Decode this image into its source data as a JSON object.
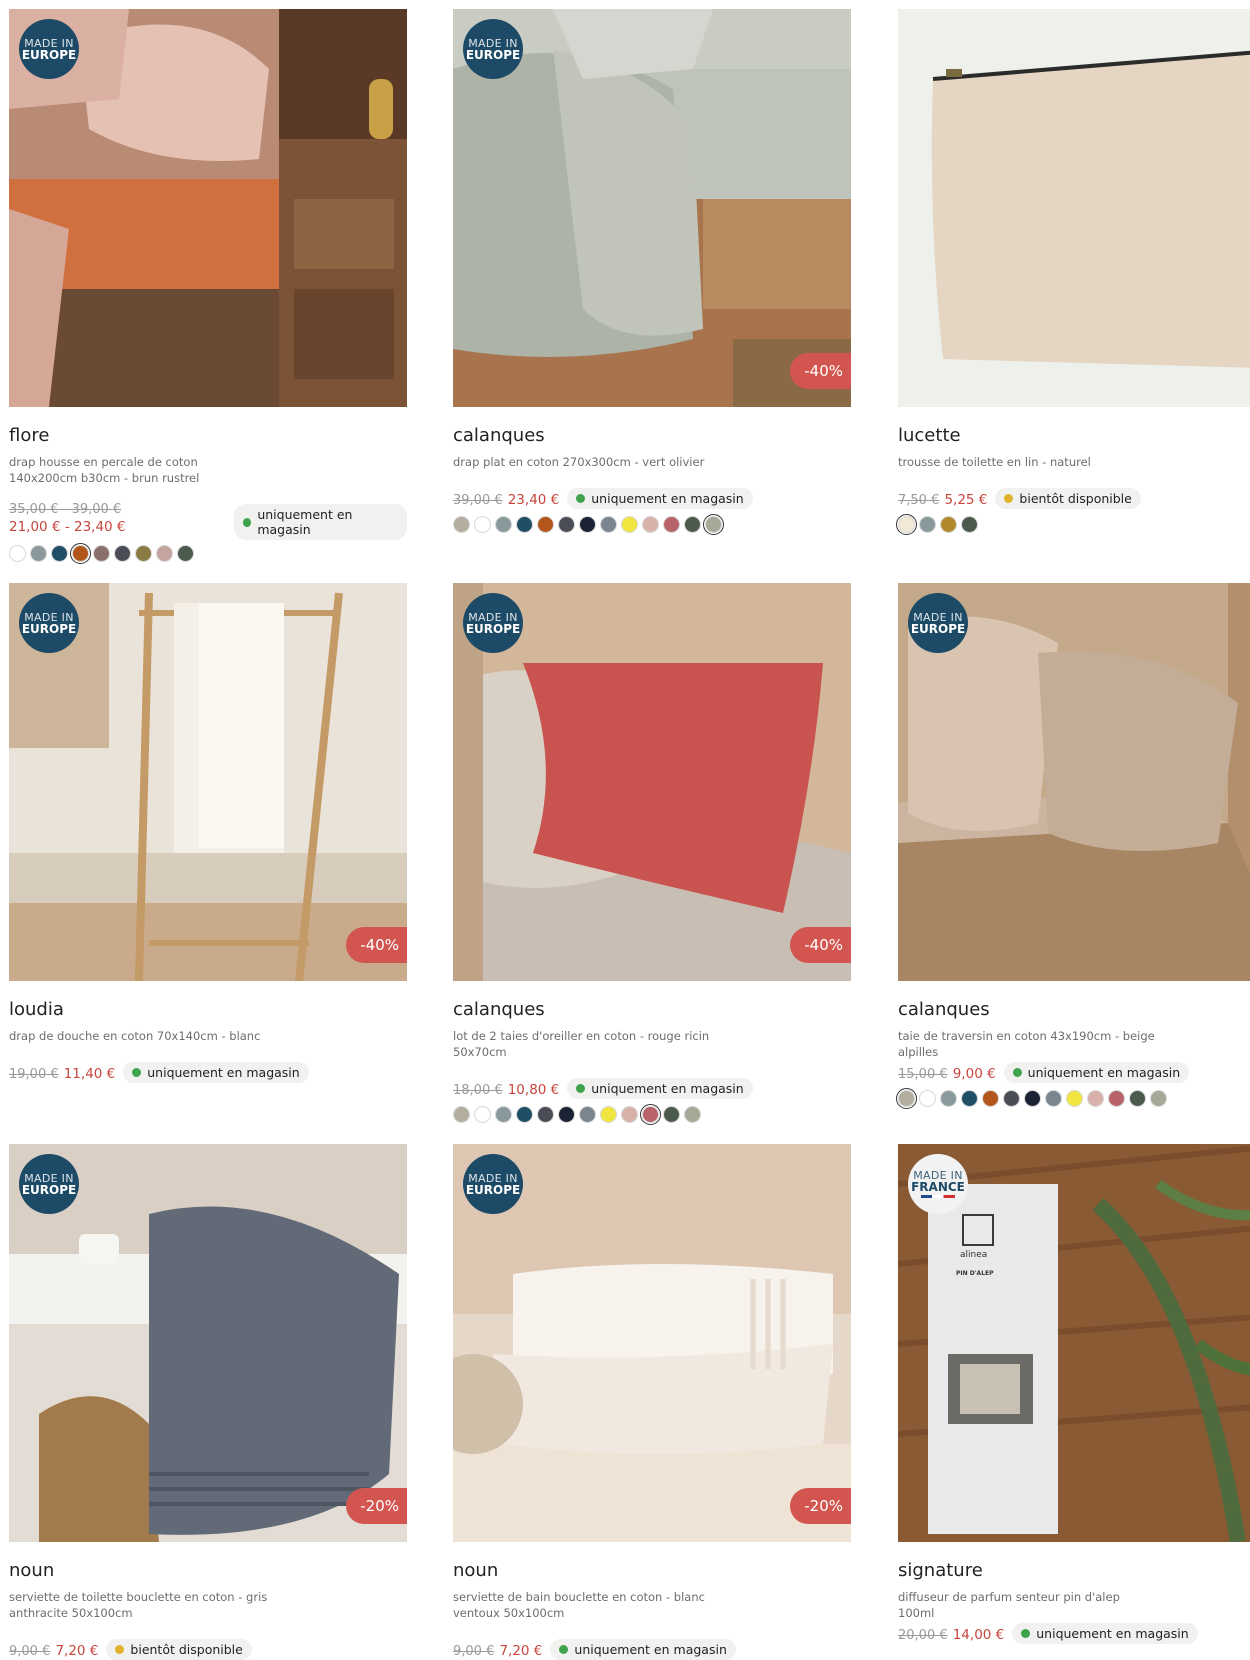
{
  "products": [
    {
      "id": "flore",
      "origin": {
        "line1": "MADE IN",
        "line2": "EUROPE",
        "type": "eu"
      },
      "discount": "",
      "name": "flore",
      "desc": "drap housse en percale de coton 140x200cm b30cm - brun rustrel",
      "old_price": "35,00 € - 39,00 €",
      "new_price": "21,00 € - 23,40 €",
      "status": {
        "label": "uniquement en magasin",
        "color": "#3fa34d"
      },
      "swatches": [
        "#ffffff",
        "#8a9a9c",
        "#1f4e66",
        "#b3561c",
        "#8a6f6a",
        "#4a4d55",
        "#8a7a44",
        "#c4a49e",
        "#4a5a4c"
      ],
      "selected_swatch": 3
    },
    {
      "id": "calanques-drap-plat",
      "origin": {
        "line1": "MADE IN",
        "line2": "EUROPE",
        "type": "eu"
      },
      "discount": "-40%",
      "name": "calanques",
      "desc": "drap plat en coton 270x300cm - vert olivier",
      "old_price": "39,00 €",
      "new_price": "23,40 €",
      "status": {
        "label": "uniquement en magasin",
        "color": "#3fa34d"
      },
      "swatches": [
        "#b4aea0",
        "#ffffff",
        "#8a9a9c",
        "#1f4e66",
        "#b3561c",
        "#4a4d55",
        "#1a2233",
        "#7a8590",
        "#f1e640",
        "#d8b2aa",
        "#b8636a",
        "#4a5a4c",
        "#a6a898"
      ],
      "selected_swatch": 12
    },
    {
      "id": "lucette",
      "origin": null,
      "discount": "cut",
      "name": "lucette",
      "desc": "trousse de toilette en lin - naturel",
      "old_price": "7,50 €",
      "new_price": "5,25 €",
      "status": {
        "label": "bientôt disponible",
        "color": "#e0b12a"
      },
      "swatches": [
        "#f3e8d6",
        "#8a9a9c",
        "#b08a2a",
        "#4a5a4c"
      ],
      "selected_swatch": 0
    },
    {
      "id": "loudia",
      "origin": {
        "line1": "MADE IN",
        "line2": "EUROPE",
        "type": "eu"
      },
      "discount": "-40%",
      "name": "loudia",
      "desc": "drap de douche en coton 70x140cm - blanc",
      "old_price": "19,00 €",
      "new_price": "11,40 €",
      "status": {
        "label": "uniquement en magasin",
        "color": "#3fa34d"
      },
      "swatches": [],
      "selected_swatch": -1
    },
    {
      "id": "calanques-taies",
      "origin": {
        "line1": "MADE IN",
        "line2": "EUROPE",
        "type": "eu"
      },
      "discount": "-40%",
      "name": "calanques",
      "desc": "lot de 2 taies d'oreiller en coton - rouge ricin 50x70cm",
      "old_price": "18,00 €",
      "new_price": "10,80 €",
      "status": {
        "label": "uniquement en magasin",
        "color": "#3fa34d"
      },
      "swatches": [
        "#b4aea0",
        "#ffffff",
        "#8a9a9c",
        "#1f4e66",
        "#4a4d55",
        "#1a2233",
        "#7a8590",
        "#f1e640",
        "#d8b2aa",
        "#b8636a",
        "#4a5a4c",
        "#a6a898"
      ],
      "selected_swatch": 9
    },
    {
      "id": "calanques-traversin",
      "origin": {
        "line1": "MADE IN",
        "line2": "EUROPE",
        "type": "eu"
      },
      "discount": "cut",
      "name": "calanques",
      "desc": "taie de traversin en coton 43x190cm - beige alpilles",
      "old_price": "15,00 €",
      "new_price": "9,00 €",
      "status": {
        "label": "uniquement en magasin",
        "color": "#3fa34d"
      },
      "swatches": [
        "#b4aea0",
        "#ffffff",
        "#8a9a9c",
        "#1f4e66",
        "#b3561c",
        "#4a4d55",
        "#1a2233",
        "#7a8590",
        "#f1e640",
        "#d8b2aa",
        "#b8636a",
        "#4a5a4c",
        "#a6a898"
      ],
      "selected_swatch": 0
    },
    {
      "id": "noun-gris",
      "origin": {
        "line1": "MADE IN",
        "line2": "EUROPE",
        "type": "eu"
      },
      "discount": "-20%",
      "name": "noun",
      "desc": "serviette de toilette bouclette en coton - gris anthracite 50x100cm",
      "old_price": "9,00 €",
      "new_price": "7,20 €",
      "status": {
        "label": "bientôt disponible",
        "color": "#e0b12a"
      },
      "swatches": [],
      "selected_swatch": -1
    },
    {
      "id": "noun-blanc",
      "origin": {
        "line1": "MADE IN",
        "line2": "EUROPE",
        "type": "eu"
      },
      "discount": "-20%",
      "name": "noun",
      "desc": "serviette de bain bouclette en coton - blanc ventoux 50x100cm",
      "old_price": "9,00 €",
      "new_price": "7,20 €",
      "status": {
        "label": "uniquement en magasin",
        "color": "#3fa34d"
      },
      "swatches": [],
      "selected_swatch": -1
    },
    {
      "id": "signature",
      "origin": {
        "line1": "MADE IN",
        "line2": "FRANCE",
        "type": "fr"
      },
      "discount": "cut",
      "name": "signature",
      "desc": "diffuseur de parfum senteur pin d'alep 100ml",
      "old_price": "20,00 €",
      "new_price": "14,00 €",
      "status": {
        "label": "uniquement en magasin",
        "color": "#3fa34d"
      },
      "swatches": [],
      "selected_swatch": -1,
      "package_text": {
        "brand": "alinea",
        "scent": "PIN D'ALEP"
      }
    }
  ]
}
